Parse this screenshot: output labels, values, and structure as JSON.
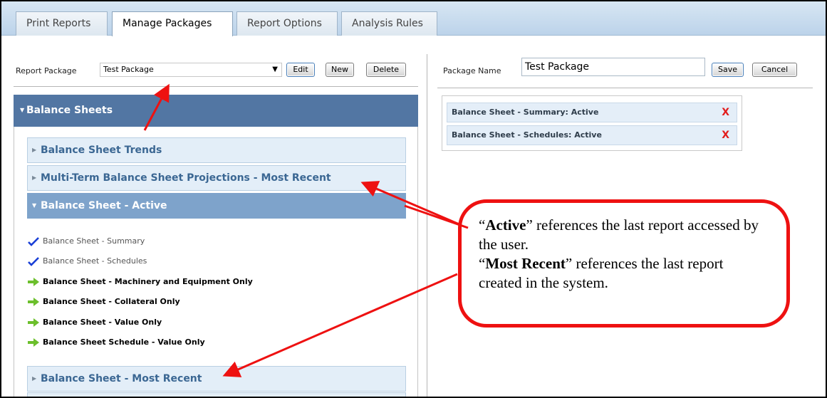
{
  "tabs": [
    {
      "label": "Print Reports"
    },
    {
      "label": "Manage Packages"
    },
    {
      "label": "Report Options"
    },
    {
      "label": "Analysis Rules"
    }
  ],
  "left": {
    "report_package_label": "Report Package",
    "report_package_value": "Test Package",
    "edit_label": "Edit",
    "new_label": "New",
    "delete_label": "Delete",
    "section_title": "Balance Sheets",
    "groups": [
      {
        "label": "Balance Sheet Trends"
      },
      {
        "label": "Multi-Term Balance Sheet Projections - Most Recent"
      },
      {
        "label": "Balance Sheet - Active"
      },
      {
        "label": "Balance Sheet - Most Recent"
      }
    ],
    "items": [
      {
        "label": "Balance Sheet - Summary",
        "state": "selected"
      },
      {
        "label": "Balance Sheet - Schedules",
        "state": "selected"
      },
      {
        "label": "Balance Sheet - Machinery and Equipment Only",
        "state": "available"
      },
      {
        "label": "Balance Sheet - Collateral Only",
        "state": "available"
      },
      {
        "label": "Balance Sheet - Value Only",
        "state": "available"
      },
      {
        "label": "Balance Sheet Schedule - Value Only",
        "state": "available"
      }
    ]
  },
  "right": {
    "package_name_label": "Package Name",
    "package_name_value": "Test Package",
    "save_label": "Save",
    "cancel_label": "Cancel",
    "package_items": [
      {
        "label": "Balance Sheet - Summary: Active",
        "remove": "X"
      },
      {
        "label": "Balance Sheet - Schedules: Active",
        "remove": "X"
      }
    ]
  },
  "callout": {
    "open_quote_1": "“",
    "bold_1": "Active",
    "text_1": "” references the last report accessed by the user.",
    "open_quote_2": "“",
    "bold_2": "Most Recent",
    "text_2": "” references the last report created in the system."
  },
  "colors": {
    "accent": "#5276a3",
    "open_group": "#7ea3cb",
    "group_bg": "#e3eef8",
    "callout_border": "#ee1111",
    "remove_x": "#e21c1c",
    "check": "#1a3fd6",
    "add_arrow": "#6cbf2c"
  },
  "icons": {
    "selected": "check-icon",
    "available": "green-arrow-icon",
    "collapsed": "triangle-right-icon",
    "expanded": "triangle-down-icon"
  }
}
